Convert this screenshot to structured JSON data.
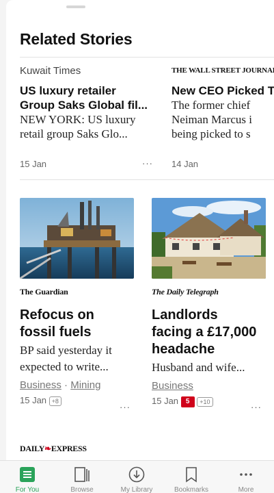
{
  "section_title": "Related Stories",
  "top_stories": [
    {
      "source": "Kuwait Times",
      "headline": "US luxury retailer Group Saks Global fil...",
      "headline_line1": "US luxury retailer",
      "headline_line2": "Group Saks Global fil...",
      "summary_line1": "NEW YORK: US luxury",
      "summary_line2": "retail group Saks Glo...",
      "date": "15 Jan",
      "more": "···"
    },
    {
      "source": "THE WALL STREET JOURNAL.",
      "headline_line1": "New CEO Picked T",
      "summary_line1": "The former chief",
      "summary_line2": "Neiman Marcus i",
      "summary_line3": "being picked to s",
      "date": "14 Jan"
    }
  ],
  "cards": [
    {
      "source": "The Guardian",
      "headline_line1": "Refocus on",
      "headline_line2": "fossil fuels",
      "summary_line1": "BP said yesterday it",
      "summary_line2": "expected to write...",
      "tag1": "Business",
      "separator": "·",
      "tag2": "Mining",
      "date": "15 Jan",
      "badge": "+8",
      "more": "···",
      "image_alt": "Offshore oil platform at sea"
    },
    {
      "source": "The Daily Telegraph",
      "headline_line1": "Landlords",
      "headline_line2": "facing a £17,000",
      "headline_line3": "headache",
      "summary_line1": "Husband and wife...",
      "tag1": "Business",
      "date": "15 Jan",
      "flag_count": "5",
      "badge": "+10",
      "more": "···",
      "image_alt": "Thatched country pub with bunting"
    }
  ],
  "next_source": "DAILY EXPRESS",
  "next_source_parts": [
    "DAILY",
    "EXPRESS"
  ],
  "tabs": [
    {
      "label": "For You",
      "icon": "for-you-icon",
      "active": true
    },
    {
      "label": "Browse",
      "icon": "browse-icon",
      "active": false
    },
    {
      "label": "My Library",
      "icon": "download-icon",
      "active": false
    },
    {
      "label": "Bookmarks",
      "icon": "bookmark-icon",
      "active": false
    },
    {
      "label": "More",
      "icon": "more-icon",
      "active": false
    }
  ],
  "colors": {
    "accent": "#2aa35a",
    "flag": "#d0021b"
  }
}
